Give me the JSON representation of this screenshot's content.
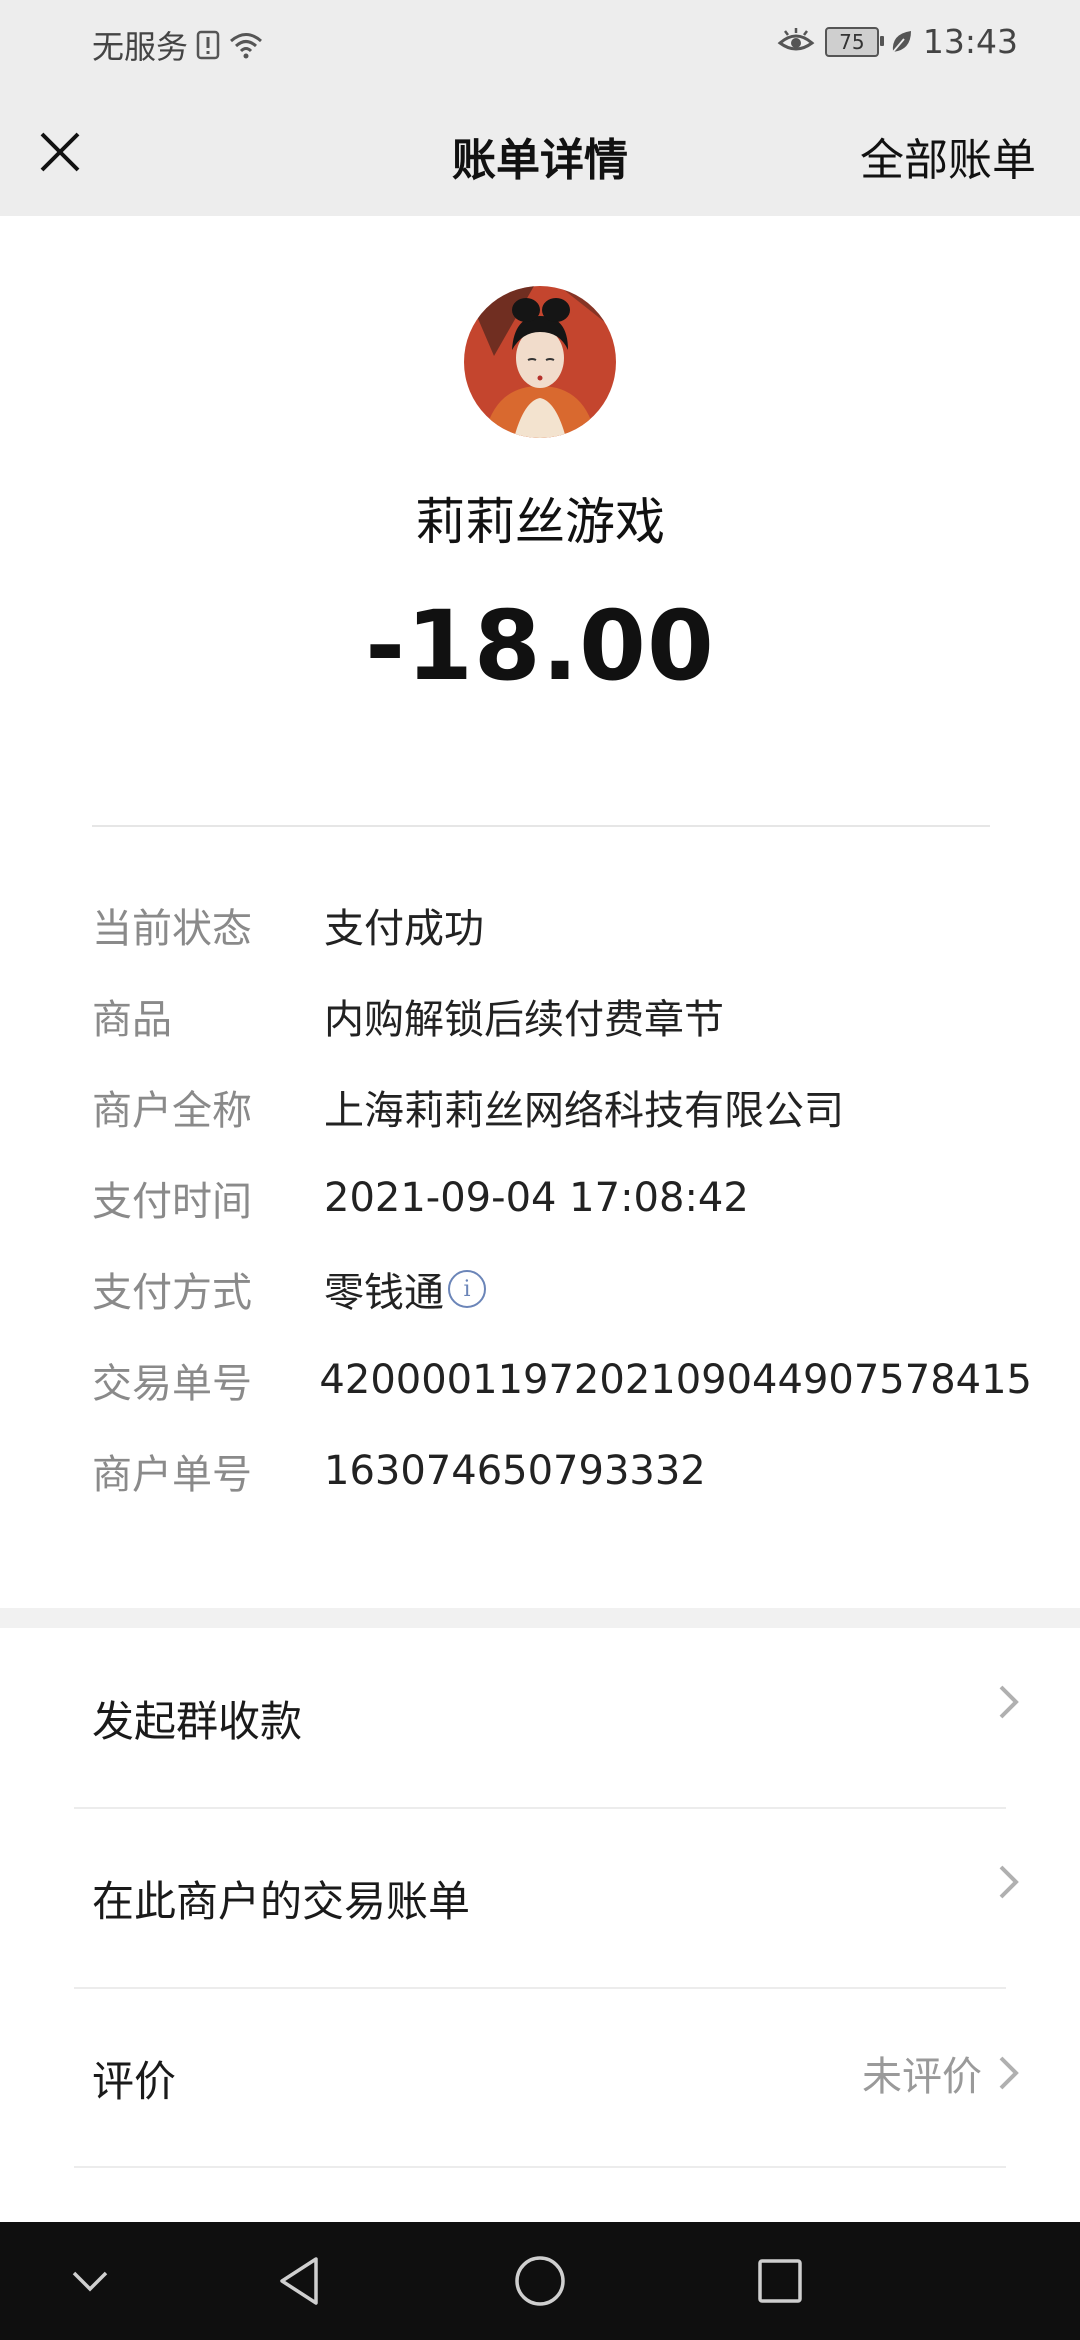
{
  "status_bar": {
    "carrier": "无服务",
    "battery": "75",
    "time": "13:43"
  },
  "header": {
    "title": "账单详情",
    "all_bills": "全部账单"
  },
  "merchant": {
    "name": "莉莉丝游戏",
    "amount": "-18.00"
  },
  "details": [
    {
      "label": "当前状态",
      "value": "支付成功"
    },
    {
      "label": "商品",
      "value": "内购解锁后续付费章节"
    },
    {
      "label": "商户全称",
      "value": "上海莉莉丝网络科技有限公司"
    },
    {
      "label": "支付时间",
      "value": "2021-09-04 17:08:42"
    },
    {
      "label": "支付方式",
      "value": "零钱通"
    },
    {
      "label": "交易单号",
      "value": "4200001197202109044907578415"
    },
    {
      "label": "商户单号",
      "value": "163074650793332"
    }
  ],
  "actions": [
    {
      "label": "发起群收款",
      "trailing": ""
    },
    {
      "label": "在此商户的交易账单",
      "trailing": ""
    },
    {
      "label": "评价",
      "trailing": "未评价"
    }
  ],
  "colors": {
    "bar_bg": "#ededed",
    "label_gray": "#8a8a8a",
    "info_blue": "#6b85b8",
    "nav_bg": "#0f0f0f"
  }
}
